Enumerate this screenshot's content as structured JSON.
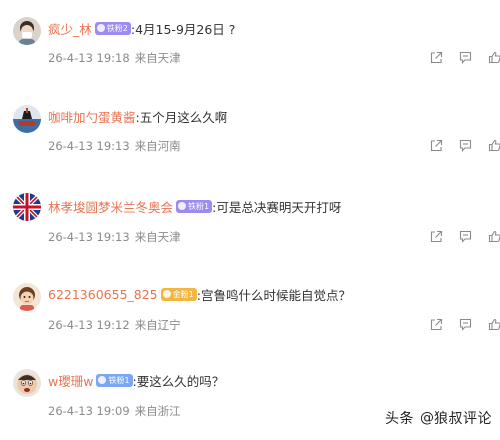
{
  "colors": {
    "name": "#eb7350",
    "meta": "#8b8b8b",
    "badge_purple": "#9b8cf2",
    "badge_gold": "#f5b641",
    "badge_blue": "#7aa6f2"
  },
  "comments": [
    {
      "name": "疯少_林",
      "badge": "铁粉2",
      "text": ":4月15-9月26日 ?",
      "date": "26-4-13 19:18",
      "location": "来自天津",
      "avatar": "avatar-masked-person"
    },
    {
      "name": "咖啡加勺蛋黄酱",
      "badge": "",
      "text": ":五个月这么久啊",
      "date": "26-4-13 19:13",
      "location": "来自河南",
      "avatar": "avatar-ship"
    },
    {
      "name": "林孝埈圆梦米兰冬奥会",
      "badge": "铁粉1",
      "text": ":可是总决赛明天开打呀",
      "date": "26-4-13 19:13",
      "location": "来自天津",
      "avatar": "avatar-flag"
    },
    {
      "name": "6221360655_825",
      "badge": "金粉1",
      "text": ":宫鲁鸣什么时候能自觉点？",
      "date": "26-4-13 19:12",
      "location": "来自辽宁",
      "avatar": "avatar-cartoon"
    },
    {
      "name": "w瓔珊w",
      "badge": "铁粉1",
      "text": ":要这么久的吗？",
      "date": "26-4-13 19:09",
      "location": "来自浙江",
      "avatar": "avatar-meme"
    }
  ],
  "watermark": {
    "prefix": "头条",
    "at": "@",
    "handle": "狼叔评论"
  }
}
